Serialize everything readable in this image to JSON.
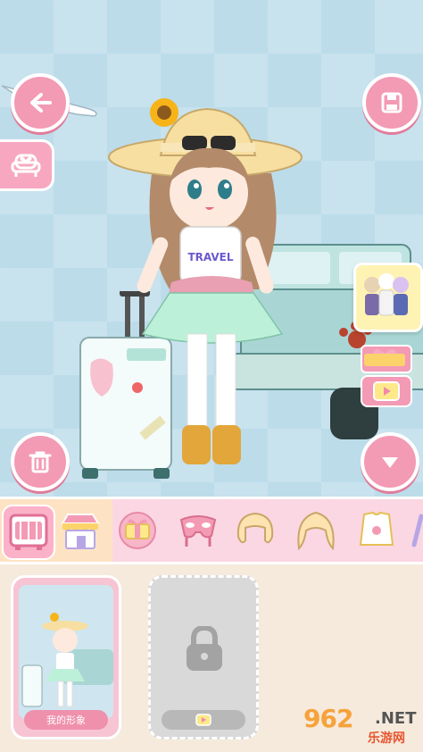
{
  "scene": {
    "shirt_text": "TRAVEL"
  },
  "buttons": {
    "back": "back-arrow-icon",
    "save": "save-floppy-icon",
    "furniture": "armchair-icon",
    "delete": "trash-icon",
    "expand": "down-triangle-icon",
    "gift": "gift-bow-icon",
    "video": "play-video-icon"
  },
  "categories": [
    {
      "name": "wardrobe",
      "icon": "wardrobe-icon",
      "active": true
    },
    {
      "name": "shop",
      "icon": "shop-icon",
      "active": false
    },
    {
      "name": "gift",
      "icon": "gift-box-icon",
      "active": false
    },
    {
      "name": "mask",
      "icon": "mask-icon",
      "active": false
    },
    {
      "name": "short-hair",
      "icon": "short-hair-icon",
      "active": false
    },
    {
      "name": "long-hair",
      "icon": "long-hair-icon",
      "active": false
    },
    {
      "name": "top",
      "icon": "shirt-icon",
      "active": false
    },
    {
      "name": "more",
      "icon": "more-icon",
      "active": false
    }
  ],
  "slots": [
    {
      "label": "我的形象",
      "locked": false
    },
    {
      "label": "",
      "locked": true
    }
  ],
  "watermark": {
    "number": "962",
    "domain": ".NET",
    "site": "乐游网"
  },
  "colors": {
    "accent_pink": "#f39ab5",
    "bar_pink": "#fbd7e3",
    "panel_bg": "#f6eadd",
    "sky_blue": "#bcdcea"
  }
}
